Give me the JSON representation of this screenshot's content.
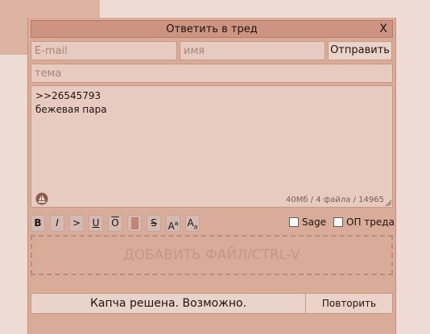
{
  "reply_form": {
    "title": "Ответить в тред",
    "close_label": "X",
    "email_placeholder": "E-mail",
    "name_placeholder": "имя",
    "send_label": "Отправить",
    "subject_placeholder": "тема",
    "comment_line1": ">>26545793",
    "comment_line2": "бежевая пара",
    "limits": "40Мб / 4 файла / 14965"
  },
  "toolbar": {
    "bold": "B",
    "italic": "I",
    "quote": ">",
    "underline": "U",
    "overline": "O",
    "strike": "S",
    "sup_main": "A",
    "sup_small": "a",
    "sub_main": "A",
    "sub_small": "a",
    "sage_label": "Sage",
    "op_label": "ОП треда"
  },
  "dropzone": {
    "label": "ДОБАВИТЬ ФАЙЛ/CTRL-V"
  },
  "captcha": {
    "status": "Капча решена. Возможно.",
    "retry_label": "Повторить"
  },
  "colors": {
    "panel": "#d9ab99",
    "titlebar": "#cc9481",
    "field": "#e8cbc0",
    "spoiler": "#c08575"
  }
}
